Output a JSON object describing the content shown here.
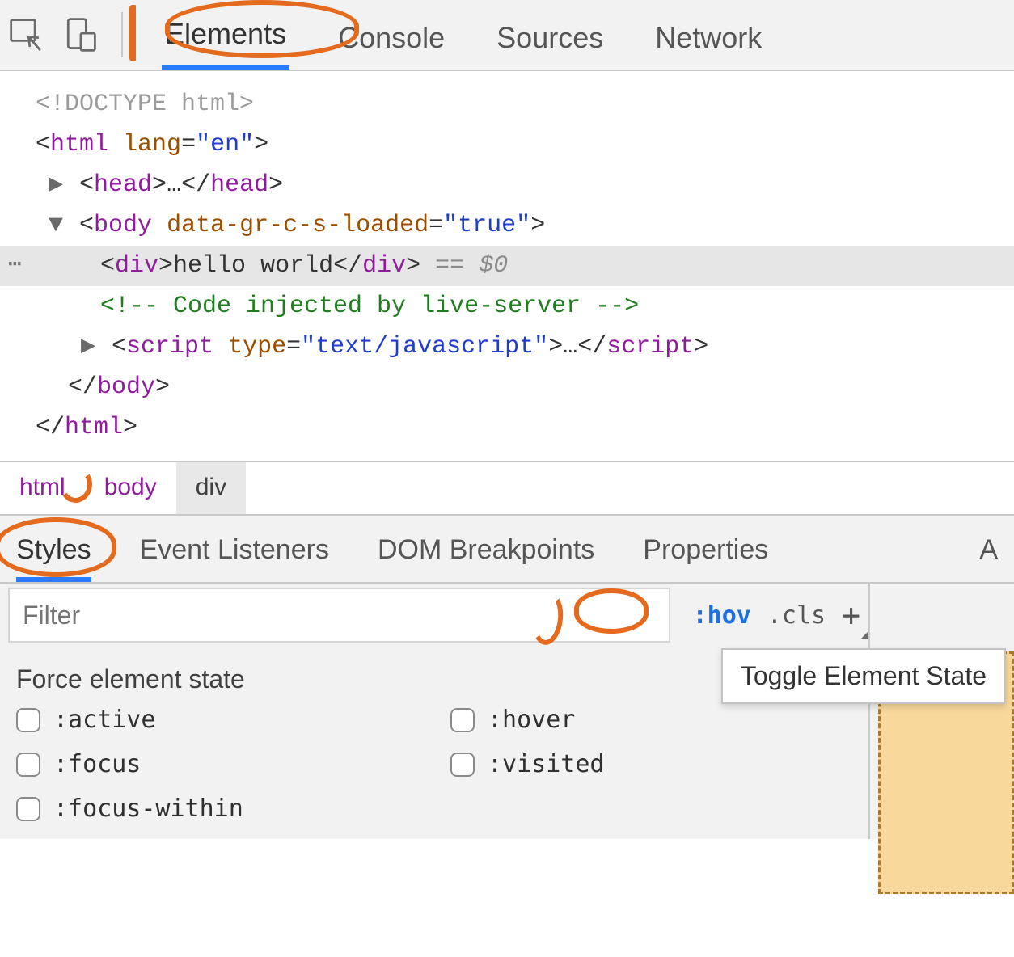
{
  "toolbar": {
    "tabs": [
      "Elements",
      "Console",
      "Sources",
      "Network"
    ],
    "active_tab_index": 0
  },
  "dom": {
    "doctype": "<!DOCTYPE html>",
    "html_open": {
      "tag": "html",
      "attr_name": "lang",
      "attr_value": "en"
    },
    "head": {
      "tag": "head",
      "ellipsis": "…"
    },
    "body_open": {
      "tag": "body",
      "attr_name": "data-gr-c-s-loaded",
      "attr_value": "true"
    },
    "selected_div": {
      "tag": "div",
      "text": "hello world",
      "eq": "==",
      "ref": "$0"
    },
    "comment": "<!-- Code injected by live-server -->",
    "script": {
      "tag": "script",
      "attr_name": "type",
      "attr_value": "text/javascript",
      "ellipsis": "…"
    },
    "body_close": "body",
    "html_close": "html"
  },
  "breadcrumb": [
    "html",
    "body",
    "div"
  ],
  "breadcrumb_selected_index": 2,
  "subtabs": [
    "Styles",
    "Event Listeners",
    "DOM Breakpoints",
    "Properties"
  ],
  "subtabs_trailing": "A",
  "subtab_active_index": 0,
  "styles": {
    "filter_placeholder": "Filter",
    "hov_label": ":hov",
    "cls_label": ".cls",
    "plus_label": "+",
    "tooltip": "Toggle Element State",
    "force_title": "Force element state",
    "states_col1": [
      ":active",
      ":focus",
      ":focus-within"
    ],
    "states_col2": [
      ":hover",
      ":visited"
    ]
  }
}
